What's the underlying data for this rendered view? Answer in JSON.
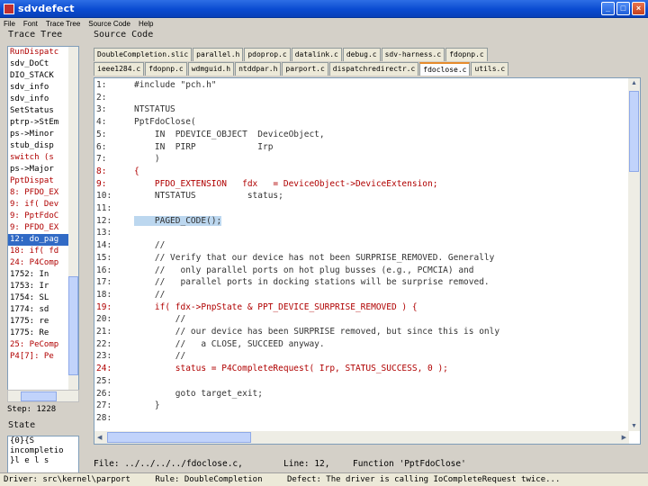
{
  "window": {
    "title": "sdvdefect"
  },
  "menu": [
    "File",
    "Font",
    "Trace Tree",
    "Source Code",
    "Help"
  ],
  "trace_tree": {
    "title": "Trace Tree",
    "items": [
      {
        "text": "RunDispatc",
        "style": "red"
      },
      {
        "text": "sdv_DoCt",
        "style": "normal"
      },
      {
        "text": "DIO_STACK",
        "style": "normal"
      },
      {
        "text": "sdv_info",
        "style": "normal"
      },
      {
        "text": "sdv_info",
        "style": "normal"
      },
      {
        "text": "SetStatus",
        "style": "normal"
      },
      {
        "text": "ptrp->StEm",
        "style": "normal"
      },
      {
        "text": "ps->Minor",
        "style": "normal"
      },
      {
        "text": "stub_disp",
        "style": "normal"
      },
      {
        "text": "switch (s",
        "style": "red"
      },
      {
        "text": "ps->Major",
        "style": "normal"
      },
      {
        "text": "PptDispat",
        "style": "red"
      },
      {
        "text": "8: PFDO_EX",
        "style": "red"
      },
      {
        "text": "9: if( Dev",
        "style": "red"
      },
      {
        "text": "9: PptFdoC",
        "style": "red"
      },
      {
        "text": "9: PFDO_EX",
        "style": "red"
      },
      {
        "text": "12: do_pag",
        "style": "sel"
      },
      {
        "text": "18: if( fd",
        "style": "red"
      },
      {
        "text": "24: P4Comp",
        "style": "red"
      },
      {
        "text": "1752: In",
        "style": "normal"
      },
      {
        "text": "1753: Ir",
        "style": "normal"
      },
      {
        "text": "1754: SL",
        "style": "normal"
      },
      {
        "text": "1774: sd",
        "style": "normal"
      },
      {
        "text": "1775: re",
        "style": "normal"
      },
      {
        "text": "1775: Re",
        "style": "normal"
      },
      {
        "text": "25: PeComp",
        "style": "red"
      },
      {
        "text": "P4[7]: Pe",
        "style": "red"
      }
    ],
    "step_label": "Step: 1228"
  },
  "state": {
    "title": "State",
    "lines": [
      "{0}{S",
      "incompletio",
      "}l  e  l s"
    ]
  },
  "source": {
    "title": "Source Code",
    "tabs_row1": [
      "DoubleCompletion.slic",
      "parallel.h",
      "pdoprop.c",
      "datalink.c",
      "debug.c",
      "sdv-harness.c",
      "fdopnp.c"
    ],
    "tabs_row2": [
      "ieee1284.c",
      "fdopnp.c",
      "wdmguid.h",
      "ntddpar.h",
      "parport.c",
      "dispatchredirectr.c",
      "fdoclose.c",
      "utils.c"
    ],
    "active_tab": "fdoclose.c",
    "lines": [
      {
        "n": "1:",
        "text": "#include \"pch.h\"",
        "style": "normal"
      },
      {
        "n": "2:",
        "text": "",
        "style": "normal"
      },
      {
        "n": "3:",
        "text": "NTSTATUS",
        "style": "normal"
      },
      {
        "n": "4:",
        "text": "PptFdoClose(",
        "style": "normal"
      },
      {
        "n": "5:",
        "text": "    IN  PDEVICE_OBJECT  DeviceObject,",
        "style": "normal"
      },
      {
        "n": "6:",
        "text": "    IN  PIRP            Irp",
        "style": "normal"
      },
      {
        "n": "7:",
        "text": "    )",
        "style": "normal"
      },
      {
        "n": "8:",
        "text": "{",
        "style": "red"
      },
      {
        "n": "9:",
        "text": "    PFDO_EXTENSION   fdx   = DeviceObject->DeviceExtension;",
        "style": "red"
      },
      {
        "n": "10:",
        "text": "    NTSTATUS          status;",
        "style": "normal"
      },
      {
        "n": "11:",
        "text": "",
        "style": "normal"
      },
      {
        "n": "12:",
        "text": "    PAGED_CODE();",
        "style": "hl"
      },
      {
        "n": "13:",
        "text": "",
        "style": "normal"
      },
      {
        "n": "14:",
        "text": "    //",
        "style": "normal"
      },
      {
        "n": "15:",
        "text": "    // Verify that our device has not been SURPRISE_REMOVED. Generally",
        "style": "normal"
      },
      {
        "n": "16:",
        "text": "    //   only parallel ports on hot plug busses (e.g., PCMCIA) and",
        "style": "normal"
      },
      {
        "n": "17:",
        "text": "    //   parallel ports in docking stations will be surprise removed.",
        "style": "normal"
      },
      {
        "n": "18:",
        "text": "    //",
        "style": "normal"
      },
      {
        "n": "19:",
        "text": "    if( fdx->PnpState & PPT_DEVICE_SURPRISE_REMOVED ) {",
        "style": "red"
      },
      {
        "n": "20:",
        "text": "        //",
        "style": "normal"
      },
      {
        "n": "21:",
        "text": "        // our device has been SURPRISE removed, but since this is only",
        "style": "normal"
      },
      {
        "n": "22:",
        "text": "        //   a CLOSE, SUCCEED anyway.",
        "style": "normal"
      },
      {
        "n": "23:",
        "text": "        //",
        "style": "normal"
      },
      {
        "n": "24:",
        "text": "        status = P4CompleteRequest( Irp, STATUS_SUCCESS, 0 );",
        "style": "red"
      },
      {
        "n": "25:",
        "text": "",
        "style": "normal"
      },
      {
        "n": "26:",
        "text": "        goto target_exit;",
        "style": "normal"
      },
      {
        "n": "27:",
        "text": "    }",
        "style": "normal"
      },
      {
        "n": "28:",
        "text": "",
        "style": "normal"
      }
    ],
    "file_label": "File: ../../../../fdoclose.c,",
    "line_label": "Line: 12,",
    "function_label": "Function 'PptFdoClose'"
  },
  "status": {
    "driver": "Driver: src\\kernel\\parport",
    "rule": "Rule: DoubleCompletion",
    "defect": "Defect: The driver is calling IoCompleteRequest twice..."
  }
}
